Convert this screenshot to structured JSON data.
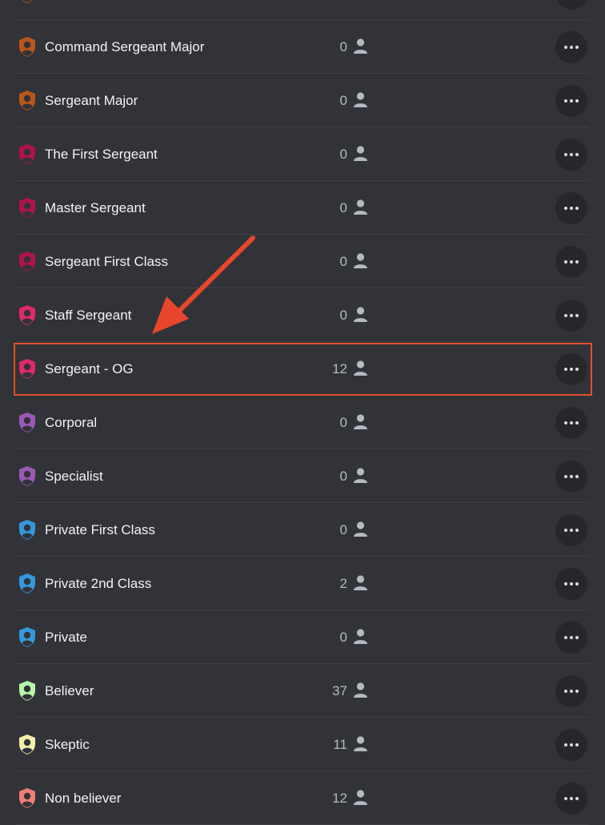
{
  "colors": {
    "background": "#313338",
    "annotation": "#e8462c",
    "orange_role": "#b9561a",
    "crimson_role": "#b1124a",
    "pink_role": "#e0296a",
    "purple_role": "#9b59b6",
    "blue_role": "#3498db",
    "green_role": "#b9f6a9",
    "yellow_role": "#f5efae",
    "salmon_role": "#f07d75"
  },
  "roles": [
    {
      "name": "",
      "count": "",
      "color": "#b9561a",
      "icon": "shield-user-icon"
    },
    {
      "name": "Command Sergeant Major",
      "count": "0",
      "color": "#b9561a",
      "icon": "shield-user-icon"
    },
    {
      "name": "Sergeant Major",
      "count": "0",
      "color": "#b9561a",
      "icon": "shield-user-icon"
    },
    {
      "name": "The First Sergeant",
      "count": "0",
      "color": "#b1124a",
      "icon": "shield-user-icon"
    },
    {
      "name": "Master Sergeant",
      "count": "0",
      "color": "#b1124a",
      "icon": "shield-user-icon"
    },
    {
      "name": "Sergeant First Class",
      "count": "0",
      "color": "#b1124a",
      "icon": "shield-user-icon"
    },
    {
      "name": "Staff Sergeant",
      "count": "0",
      "color": "#e0296a",
      "icon": "shield-user-icon"
    },
    {
      "name": "Sergeant - OG",
      "count": "12",
      "color": "#e0296a",
      "icon": "shield-user-icon",
      "highlighted": true
    },
    {
      "name": "Corporal",
      "count": "0",
      "color": "#9b59b6",
      "icon": "shield-user-icon"
    },
    {
      "name": "Specialist",
      "count": "0",
      "color": "#9b59b6",
      "icon": "shield-user-icon"
    },
    {
      "name": "Private First Class",
      "count": "0",
      "color": "#3498db",
      "icon": "shield-user-icon"
    },
    {
      "name": "Private 2nd Class",
      "count": "2",
      "color": "#3498db",
      "icon": "shield-user-icon"
    },
    {
      "name": "Private",
      "count": "0",
      "color": "#3498db",
      "icon": "shield-user-icon"
    },
    {
      "name": "Believer",
      "count": "37",
      "color": "#b9f6a9",
      "icon": "shield-user-icon"
    },
    {
      "name": "Skeptic",
      "count": "11",
      "color": "#f5efae",
      "icon": "shield-user-icon"
    },
    {
      "name": "Non believer",
      "count": "12",
      "color": "#f07d75",
      "icon": "shield-user-icon"
    }
  ],
  "icons": {
    "member": "person-icon",
    "more": "more-options-icon",
    "annotation": "red-arrow-icon"
  }
}
